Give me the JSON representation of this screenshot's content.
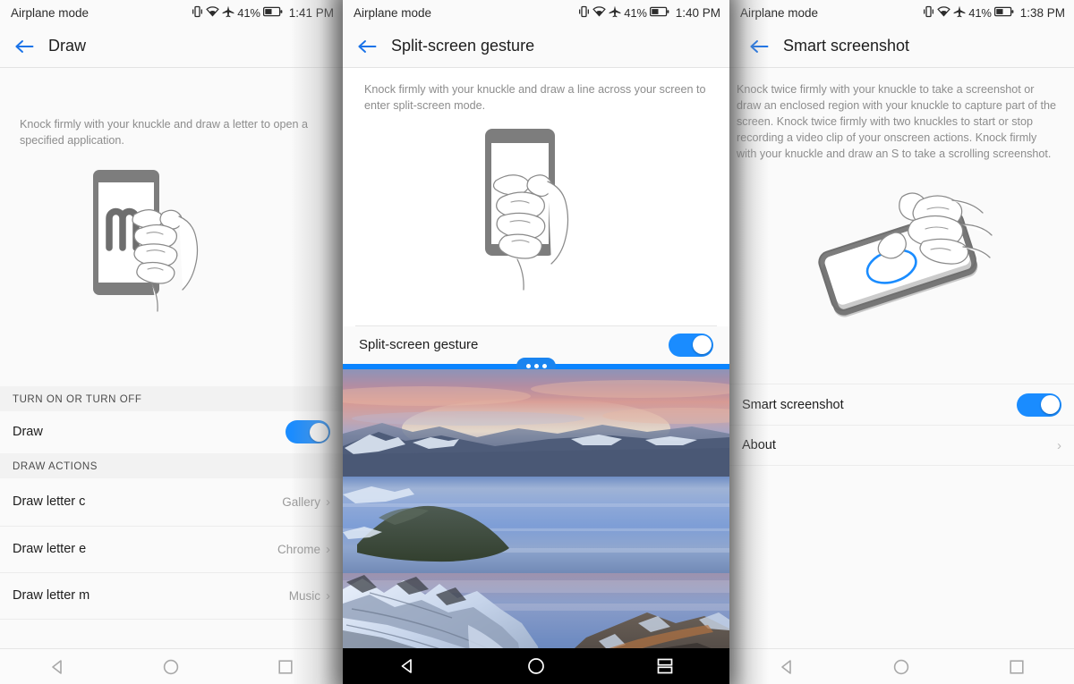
{
  "panels": {
    "draw": {
      "statusbar": {
        "left_text": "Airplane mode",
        "battery_pct": "41%",
        "time": "1:41 PM",
        "icons": [
          "vibrate-icon",
          "wifi-icon",
          "airplane-icon",
          "battery-icon"
        ]
      },
      "appbar": {
        "back_icon": "back-arrow-icon",
        "title": "Draw"
      },
      "description": "Knock firmly with your knuckle and draw a letter to open a specified application.",
      "illustration": {
        "name": "phone-knuckle-letter-m-illustration",
        "letter": "M"
      },
      "sections": [
        {
          "header": "TURN ON OR TURN OFF",
          "rows": [
            {
              "label": "Draw",
              "type": "toggle",
              "value": "on"
            }
          ]
        },
        {
          "header": "DRAW ACTIONS",
          "rows": [
            {
              "label": "Draw letter c",
              "type": "link",
              "value": "Gallery"
            },
            {
              "label": "Draw letter e",
              "type": "link",
              "value": "Chrome"
            },
            {
              "label": "Draw letter m",
              "type": "link",
              "value": "Music"
            }
          ]
        }
      ],
      "navbar": {
        "theme": "light",
        "buttons": [
          "back-nav-icon",
          "home-nav-icon",
          "recents-nav-icon"
        ]
      }
    },
    "split": {
      "statusbar": {
        "left_text": "Airplane mode",
        "battery_pct": "41%",
        "time": "1:40 PM",
        "icons": [
          "vibrate-icon",
          "wifi-icon",
          "airplane-icon",
          "battery-icon"
        ]
      },
      "appbar": {
        "back_icon": "back-arrow-icon",
        "title": "Split-screen gesture"
      },
      "description": "Knock firmly with your knuckle and draw a line across your screen to enter split-screen mode.",
      "illustration": {
        "name": "phone-knuckle-line-illustration"
      },
      "rows": [
        {
          "label": "Split-screen gesture",
          "type": "toggle",
          "value": "on"
        }
      ],
      "divider": {
        "name": "split-screen-divider-handle",
        "dots": 3,
        "color": "#0a84ff"
      },
      "wallpaper": {
        "name": "crater-lake-sunset-wallpaper"
      },
      "navbar": {
        "theme": "dark",
        "buttons": [
          "back-nav-icon",
          "home-nav-icon",
          "split-screen-nav-icon"
        ]
      }
    },
    "shot": {
      "statusbar": {
        "left_text": "Airplane mode",
        "battery_pct": "41%",
        "time": "1:38 PM",
        "icons": [
          "vibrate-icon",
          "wifi-icon",
          "airplane-icon",
          "battery-icon"
        ]
      },
      "appbar": {
        "back_icon": "back-arrow-icon",
        "title": "Smart screenshot"
      },
      "description": "Knock twice firmly with your knuckle to take a screenshot or draw an enclosed region with your knuckle to capture part of the screen. Knock twice firmly with two knuckles to start or stop recording a video clip of your onscreen actions. Knock firmly with your knuckle and draw an S to take a scrolling screenshot.",
      "illustration": {
        "name": "tilted-phone-knock-circle-illustration",
        "accent": "#1a8cff"
      },
      "rows": [
        {
          "label": "Smart screenshot",
          "type": "toggle",
          "value": "on"
        },
        {
          "label": "About",
          "type": "link",
          "value": ""
        }
      ],
      "navbar": {
        "theme": "light",
        "buttons": [
          "back-nav-icon",
          "home-nav-icon",
          "recents-nav-icon"
        ]
      }
    }
  },
  "colors": {
    "accent": "#1a8cff",
    "divider_blue": "#0a84ff",
    "text": "#1d1d1d",
    "muted": "#8c8c8c"
  }
}
